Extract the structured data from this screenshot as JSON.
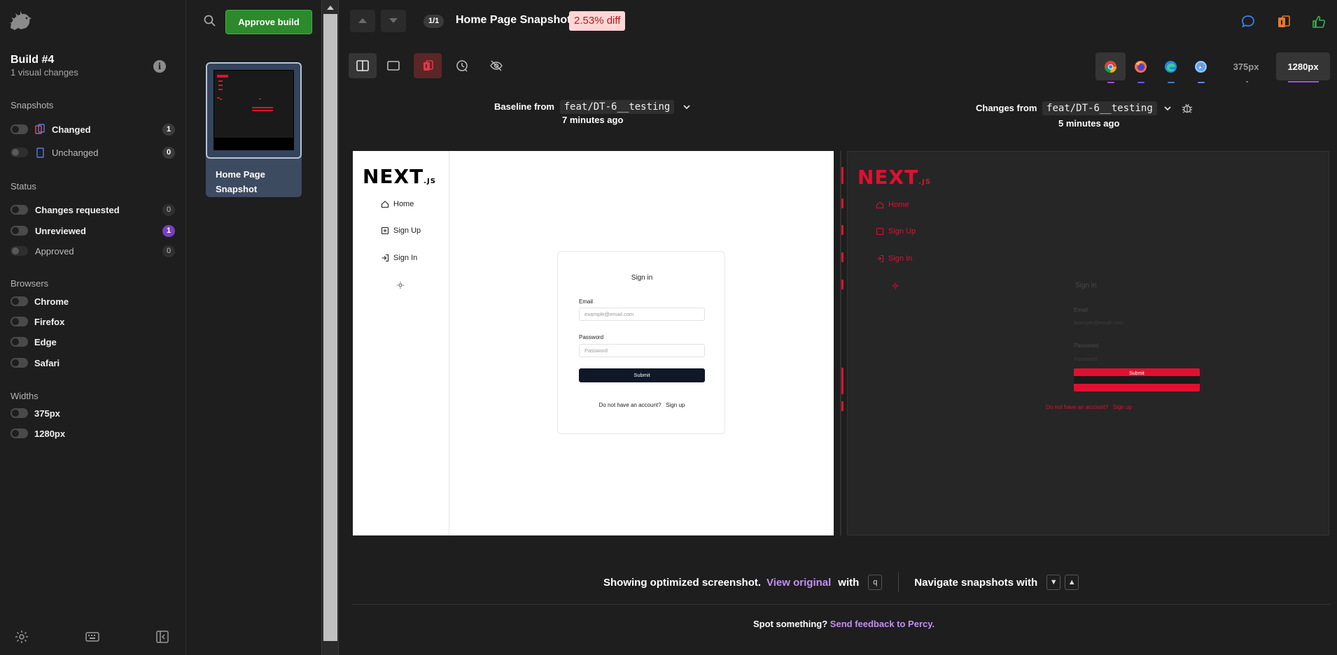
{
  "sidebar": {
    "build_title": "Build #4",
    "build_subtitle": "1 visual changes",
    "info_label": "i",
    "sections": {
      "snapshots": "Snapshots",
      "status": "Status",
      "browsers": "Browsers",
      "widths": "Widths"
    },
    "snapshot_filters": [
      {
        "label": "Changed",
        "count": "1"
      },
      {
        "label": "Unchanged",
        "count": "0"
      }
    ],
    "status_filters": [
      {
        "label": "Changes requested",
        "count": "0"
      },
      {
        "label": "Unreviewed",
        "count": "1"
      },
      {
        "label": "Approved",
        "count": "0"
      }
    ],
    "browser_filters": [
      "Chrome",
      "Firefox",
      "Edge",
      "Safari"
    ],
    "width_filters": [
      "375px",
      "1280px"
    ]
  },
  "list": {
    "approve_label": "Approve build",
    "snapshot_name": "Home Page Snapshot"
  },
  "header": {
    "counter": "1/1",
    "title": "Home Page Snapshot",
    "diff": "2.53% diff"
  },
  "widths": {
    "w375": "375px",
    "w1280": "1280px"
  },
  "compare": {
    "baseline_prefix": "Baseline from",
    "baseline_branch": "feat/DT-6__testing",
    "baseline_time": "7 minutes ago",
    "changes_prefix": "Changes from",
    "changes_branch": "feat/DT-6__testing",
    "changes_time": "5 minutes ago"
  },
  "screenshot": {
    "logo_main": "NEXT",
    "logo_sub": ".JS",
    "nav": [
      "Home",
      "Sign Up",
      "Sign In"
    ],
    "card_title": "Sign in",
    "email_label": "Email",
    "email_placeholder": "example@email.com",
    "password_label": "Password",
    "password_placeholder": "Password",
    "submit": "Submit",
    "footer_text": "Do not have an account?",
    "footer_link": "Sign up"
  },
  "bottom": {
    "showing": "Showing optimized screenshot.",
    "view_original": "View original",
    "with1": "with",
    "key_q": "q",
    "navigate": "Navigate snapshots with",
    "key_down": "▼",
    "key_up": "▲",
    "spot": "Spot something?",
    "feedback": "Send feedback to Percy."
  },
  "colors": {
    "approve": "#2c8a2c",
    "accent_purple": "#c58ef0",
    "diff_red": "#e01030",
    "diff_badge_bg": "#ffd6d6"
  }
}
